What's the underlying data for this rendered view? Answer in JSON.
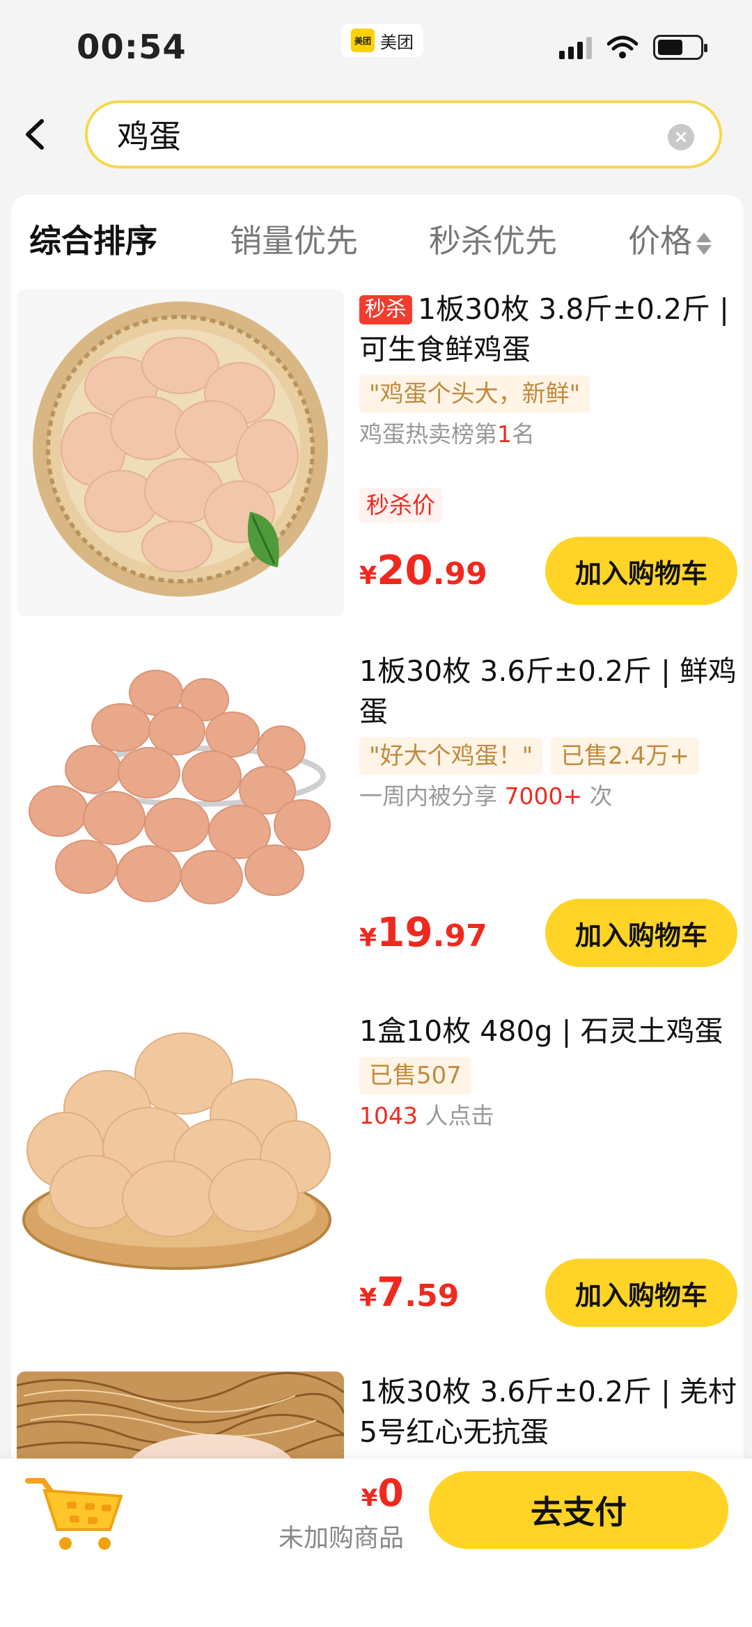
{
  "status_bar": {
    "time": "00:54",
    "app_label": "美团",
    "app_logo_text": "美团"
  },
  "search": {
    "query": "鸡蛋",
    "clear_icon": "clear-icon"
  },
  "sort_tabs": [
    {
      "label": "综合排序",
      "active": true
    },
    {
      "label": "销量优先",
      "active": false
    },
    {
      "label": "秒杀优先",
      "active": false
    },
    {
      "label": "价格",
      "active": false
    }
  ],
  "products": [
    {
      "badge": "秒杀",
      "title": "1板30枚 3.8斤±0.2斤 | 可生食鲜鸡蛋",
      "tags": [
        "\"鸡蛋个头大，新鲜\""
      ],
      "sub_prefix": "鸡蛋热卖榜第",
      "sub_highlight": "1",
      "sub_suffix": "名",
      "price_label": "秒杀价",
      "price_currency": "¥",
      "price_int": "20",
      "price_dec": ".99",
      "cta": "加入购物车"
    },
    {
      "title": "1板30枚 3.6斤±0.2斤 | 鲜鸡蛋",
      "tags": [
        "\"好大个鸡蛋！\"",
        "已售2.4万+"
      ],
      "sub_prefix": "一周内被分享 ",
      "sub_highlight": "7000+",
      "sub_suffix": " 次",
      "price_currency": "¥",
      "price_int": "19",
      "price_dec": ".97",
      "cta": "加入购物车"
    },
    {
      "title": "1盒10枚 480g | 石灵土鸡蛋",
      "tags": [
        "已售507"
      ],
      "sub_prefix": "",
      "sub_highlight": "1043",
      "sub_suffix": " 人点击",
      "price_currency": "¥",
      "price_int": "7",
      "price_dec": ".59",
      "cta": "加入购物车"
    },
    {
      "title": "1板30枚 3.6斤±0.2斤 | 羌村5号红心无抗蛋"
    }
  ],
  "bottom_bar": {
    "total_currency": "¥",
    "total_value": "0",
    "note": "未加购商品",
    "pay_label": "去支付"
  },
  "colors": {
    "accent": "#ffd426",
    "price_red": "#f0291f",
    "tag_bg": "#fff4e6"
  }
}
